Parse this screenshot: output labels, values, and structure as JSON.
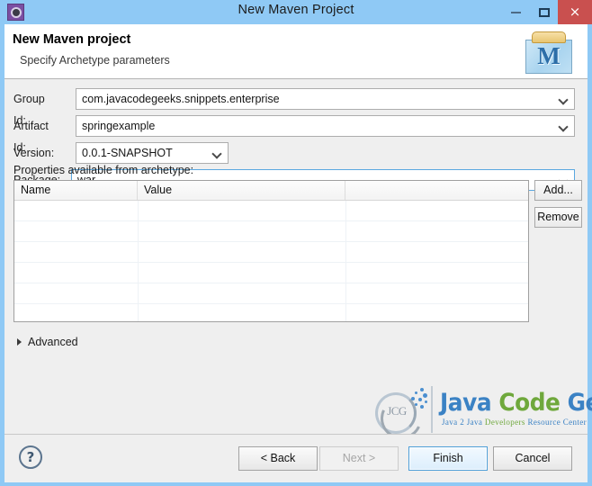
{
  "window": {
    "title": "New Maven Project",
    "icon": "eclipse-icon",
    "controls": {
      "minimize": "minimize-icon",
      "maximize": "maximize-icon",
      "close": "×"
    },
    "colors": {
      "titlebar": "#8fc9f5",
      "close_button": "#c9504f",
      "dialog_background": "#efefef",
      "accent_focus": "#5aa8e0"
    }
  },
  "header": {
    "title": "New Maven project",
    "subtitle": "Specify Archetype parameters",
    "logo_letter": "M",
    "logo_name": "maven-logo"
  },
  "form": {
    "fields": [
      {
        "label": "Group Id:",
        "value": "com.javacodegeeks.snippets.enterprise",
        "name": "group-id"
      },
      {
        "label": "Artifact Id:",
        "value": "springexample",
        "name": "artifact-id"
      },
      {
        "label": "Version:",
        "value": "0.0.1-SNAPSHOT",
        "name": "version"
      },
      {
        "label": "Package:",
        "value": "war",
        "name": "package"
      }
    ]
  },
  "properties": {
    "label": "Properties available from archetype:",
    "columns": [
      "Name",
      "Value",
      ""
    ],
    "rows": [],
    "buttons": {
      "add": "Add...",
      "remove": "Remove"
    }
  },
  "advanced": {
    "label": "Advanced",
    "expanded": false
  },
  "watermark": {
    "mark_text": "JCG",
    "word1": "Java",
    "word2": "Code",
    "word3": "Geeks",
    "tagline_1": "Java 2 Java",
    "tagline_2": "Developers",
    "tagline_3": "Resource Center"
  },
  "footer": {
    "help": "?",
    "back": "< Back",
    "next": "Next >",
    "finish": "Finish",
    "cancel": "Cancel"
  }
}
